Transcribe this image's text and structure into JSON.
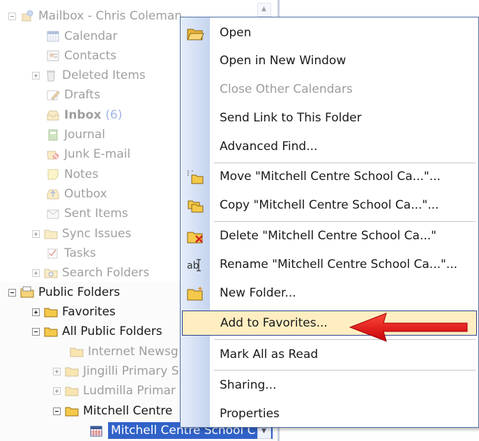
{
  "tree": {
    "mailbox": {
      "label": "Mailbox - Chris Coleman",
      "items": [
        {
          "label": "Calendar"
        },
        {
          "label": "Contacts"
        },
        {
          "label": "Deleted Items"
        },
        {
          "label": "Drafts"
        },
        {
          "label": "Inbox",
          "count": "(6)"
        },
        {
          "label": "Journal"
        },
        {
          "label": "Junk E-mail"
        },
        {
          "label": "Notes"
        },
        {
          "label": "Outbox"
        },
        {
          "label": "Sent Items"
        },
        {
          "label": "Sync Issues"
        },
        {
          "label": "Tasks"
        },
        {
          "label": "Search Folders"
        }
      ]
    },
    "public_folders": {
      "label": "Public Folders",
      "favorites": "Favorites",
      "all_public": "All Public Folders",
      "children": [
        {
          "label": "Internet Newsg"
        },
        {
          "label": "Jingilli Primary S"
        },
        {
          "label": "Ludmilla Primar"
        },
        {
          "label": "Mitchell Centre"
        }
      ],
      "selected": "Mitchell Centre School C"
    }
  },
  "menu": {
    "items": [
      {
        "label": "Open"
      },
      {
        "label": "Open in New Window"
      },
      {
        "label": "Close Other Calendars"
      },
      {
        "label": "Send Link to This Folder"
      },
      {
        "label": "Advanced Find..."
      },
      {
        "label": "Move \"Mitchell Centre School Ca...\"..."
      },
      {
        "label": "Copy \"Mitchell Centre School Ca...\"..."
      },
      {
        "label": "Delete \"Mitchell Centre School Ca...\""
      },
      {
        "label": "Rename \"Mitchell Centre School Ca...\"..."
      },
      {
        "label": "New Folder..."
      },
      {
        "label": "Add to Favorites..."
      },
      {
        "label": "Mark All as Read"
      },
      {
        "label": "Sharing..."
      },
      {
        "label": "Properties"
      }
    ]
  },
  "colors": {
    "selection": "#3162c8",
    "menu_highlight": "#ffeec2",
    "arrow": "#e8141a"
  }
}
